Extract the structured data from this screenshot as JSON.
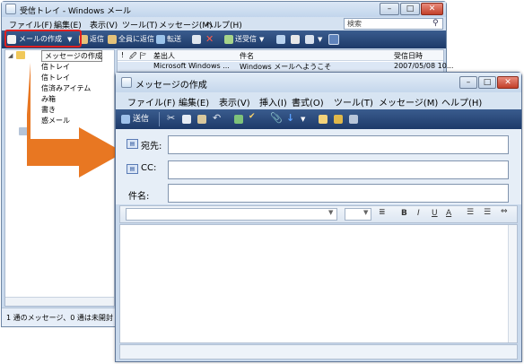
{
  "bg_window": {
    "title": "受信トレイ - Windows メール",
    "controls": {
      "minimize": "–",
      "maximize": "□",
      "close": "✕"
    },
    "menu": [
      "ファイル(F)",
      "編集(E)",
      "表示(V)",
      "ツール(T)",
      "メッセージ(M)",
      "ヘルプ(H)"
    ],
    "search_placeholder": "検索",
    "toolbar": {
      "compose": "メールの作成",
      "reply": "返信",
      "reply_all": "全員に返信",
      "forward": "転送",
      "send_receive": "送受信"
    },
    "tooltip": "メッセージの作成",
    "folders": [
      "信トレイ",
      "信トレイ",
      "信済みアイテム",
      "み箱",
      "書き",
      "惑メール"
    ],
    "columns": {
      "flag1": "!",
      "flag2": "🖉",
      "flag3": "🏱",
      "from": "差出人",
      "subject": "件名",
      "date": "受信日時"
    },
    "messages": [
      {
        "from": "Microsoft Windows ...",
        "subject": "Windows メールへようこそ",
        "date": "2007/05/08 10..."
      }
    ],
    "status": "1 通のメッセージ、0 通は未開封"
  },
  "compose_window": {
    "title": "メッセージの作成",
    "controls": {
      "minimize": "–",
      "maximize": "□",
      "close": "✕"
    },
    "menu": [
      "ファイル(F)",
      "編集(E)",
      "表示(V)",
      "挿入(I)",
      "書式(O)",
      "ツール(T)",
      "メッセージ(M)",
      "ヘルプ(H)"
    ],
    "toolbar": {
      "send": "送信"
    },
    "fields": {
      "to": "宛先:",
      "cc": "CC:",
      "subject": "件名:",
      "to_value": "",
      "cc_value": "",
      "subject_value": ""
    },
    "format_buttons": {
      "bold": "B",
      "italic": "I",
      "underline": "U",
      "font_color": "A"
    }
  },
  "colors": {
    "highlight": "#e02020",
    "arrow": "#e87722",
    "toolbar": "#1d3a69"
  }
}
